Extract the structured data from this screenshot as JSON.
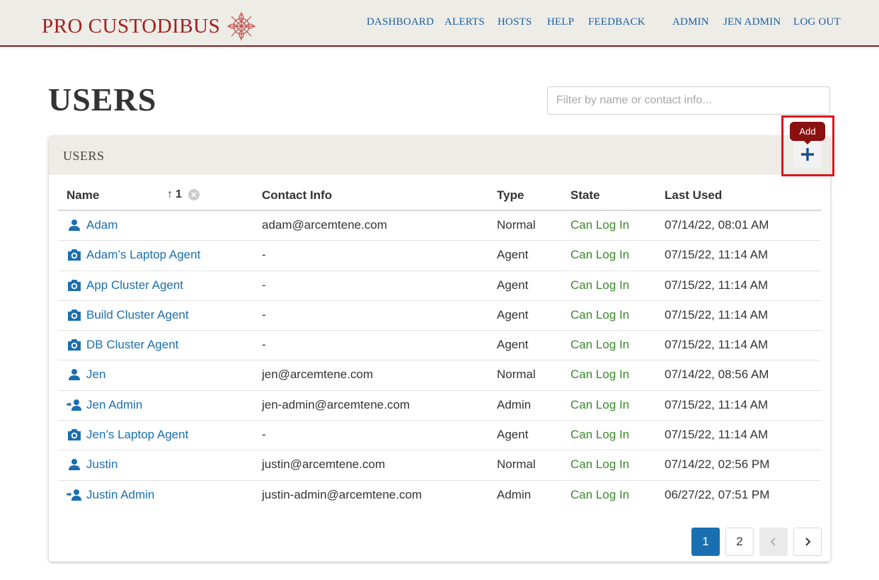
{
  "brand": {
    "name": "PRO CUSTODIBUS",
    "logo_icon": "mandala-logo-icon",
    "color": "#a02020"
  },
  "nav": {
    "dashboard": "DASHBOARD",
    "alerts": "ALERTS",
    "hosts": "HOSTS",
    "help": "HELP",
    "feedback": "FEEDBACK",
    "admin": "ADMIN",
    "user": "JEN ADMIN",
    "logout": "LOG OUT"
  },
  "page": {
    "title": "USERS",
    "filter_placeholder": "Filter by name or contact info..."
  },
  "card": {
    "title": "USERS",
    "add_tooltip": "Add",
    "add_icon": "plus-icon"
  },
  "table": {
    "headers": {
      "name": "Name",
      "sort_arrow": "↑",
      "sort_order": "1",
      "contact": "Contact Info",
      "type": "Type",
      "state": "State",
      "last_used": "Last Used"
    },
    "rows": [
      {
        "icon": "user-icon",
        "name": "Adam",
        "contact": "adam@arcemtene.com",
        "type": "Normal",
        "state": "Can Log In",
        "last_used": "07/14/22, 08:01 AM"
      },
      {
        "icon": "agent-icon",
        "name": "Adam’s Laptop Agent",
        "contact": "-",
        "type": "Agent",
        "state": "Can Log In",
        "last_used": "07/15/22, 11:14 AM"
      },
      {
        "icon": "agent-icon",
        "name": "App Cluster Agent",
        "contact": "-",
        "type": "Agent",
        "state": "Can Log In",
        "last_used": "07/15/22, 11:14 AM"
      },
      {
        "icon": "agent-icon",
        "name": "Build Cluster Agent",
        "contact": "-",
        "type": "Agent",
        "state": "Can Log In",
        "last_used": "07/15/22, 11:14 AM"
      },
      {
        "icon": "agent-icon",
        "name": "DB Cluster Agent",
        "contact": "-",
        "type": "Agent",
        "state": "Can Log In",
        "last_used": "07/15/22, 11:14 AM"
      },
      {
        "icon": "user-icon",
        "name": "Jen",
        "contact": "jen@arcemtene.com",
        "type": "Normal",
        "state": "Can Log In",
        "last_used": "07/14/22, 08:56 AM"
      },
      {
        "icon": "admin-user-icon",
        "name": "Jen Admin",
        "contact": "jen-admin@arcemtene.com",
        "type": "Admin",
        "state": "Can Log In",
        "last_used": "07/15/22, 11:14 AM"
      },
      {
        "icon": "agent-icon",
        "name": "Jen’s Laptop Agent",
        "contact": "-",
        "type": "Agent",
        "state": "Can Log In",
        "last_used": "07/15/22, 11:14 AM"
      },
      {
        "icon": "user-icon",
        "name": "Justin",
        "contact": "justin@arcemtene.com",
        "type": "Normal",
        "state": "Can Log In",
        "last_used": "07/14/22, 02:56 PM"
      },
      {
        "icon": "admin-user-icon",
        "name": "Justin Admin",
        "contact": "justin-admin@arcemtene.com",
        "type": "Admin",
        "state": "Can Log In",
        "last_used": "06/27/22, 07:51 PM"
      }
    ]
  },
  "pagination": {
    "pages": [
      "1",
      "2"
    ],
    "current": "1",
    "prev_icon": "chevron-left-icon",
    "next_icon": "chevron-right-icon"
  },
  "colors": {
    "link": "#1a6fb0",
    "state_ok": "#3a8a2a",
    "tooltip_bg": "#8b1010",
    "highlight": "#e0141c"
  }
}
